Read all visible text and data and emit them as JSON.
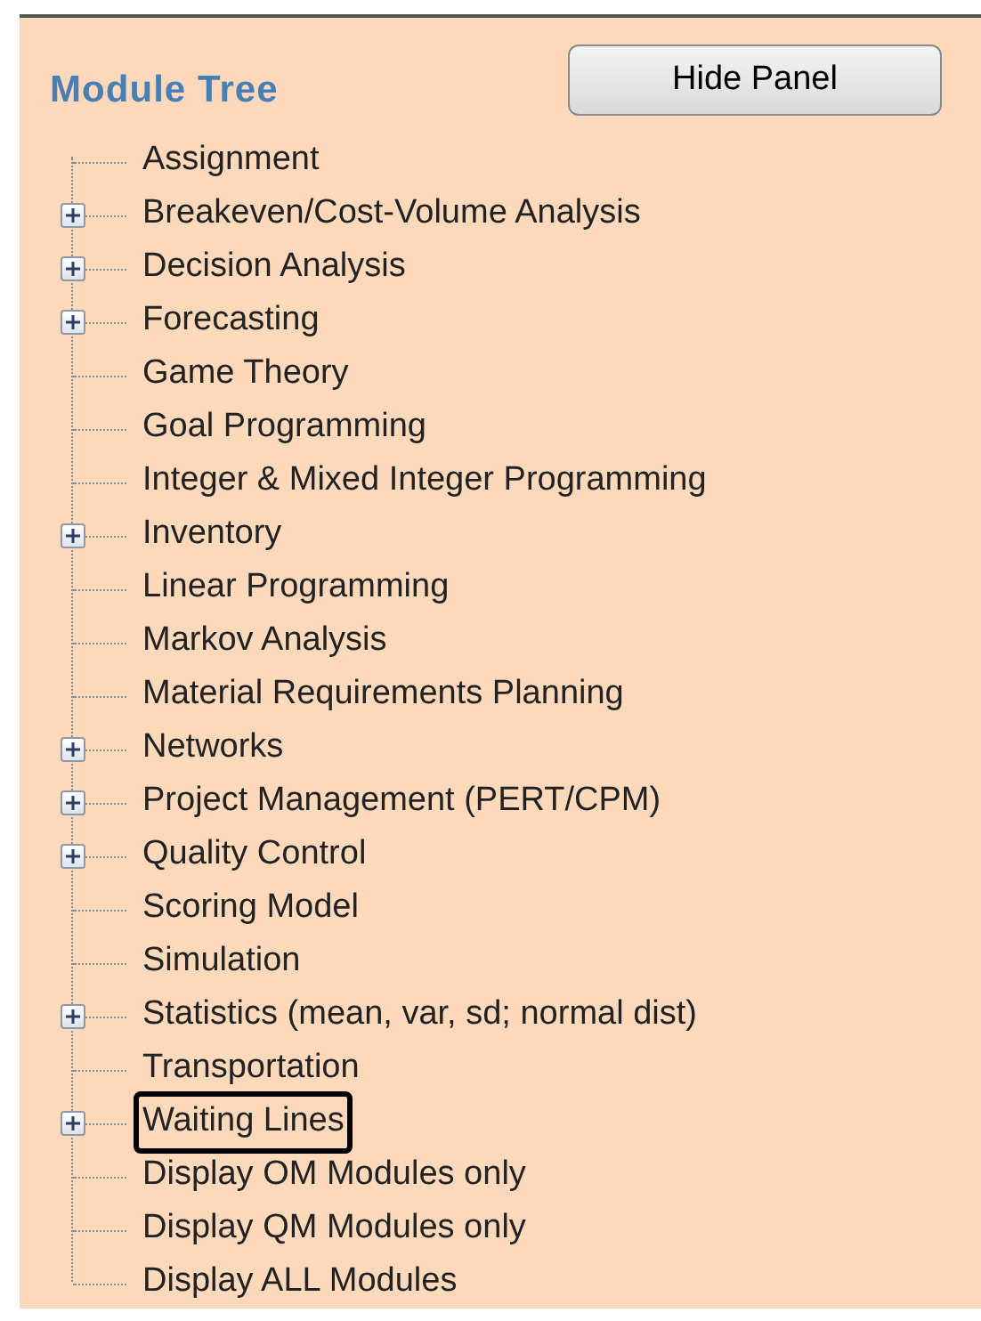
{
  "panel": {
    "title": "Module Tree",
    "hide_button": "Hide Panel"
  },
  "tree": [
    {
      "label": "Assignment",
      "expandable": false,
      "circled": false
    },
    {
      "label": "Breakeven/Cost-Volume Analysis",
      "expandable": true,
      "circled": false
    },
    {
      "label": "Decision Analysis",
      "expandable": true,
      "circled": false
    },
    {
      "label": "Forecasting",
      "expandable": true,
      "circled": false
    },
    {
      "label": "Game Theory",
      "expandable": false,
      "circled": false
    },
    {
      "label": "Goal Programming",
      "expandable": false,
      "circled": false
    },
    {
      "label": "Integer & Mixed Integer Programming",
      "expandable": false,
      "circled": false
    },
    {
      "label": "Inventory",
      "expandable": true,
      "circled": false
    },
    {
      "label": "Linear Programming",
      "expandable": false,
      "circled": false
    },
    {
      "label": "Markov Analysis",
      "expandable": false,
      "circled": false
    },
    {
      "label": "Material Requirements Planning",
      "expandable": false,
      "circled": false
    },
    {
      "label": "Networks",
      "expandable": true,
      "circled": false
    },
    {
      "label": "Project Management (PERT/CPM)",
      "expandable": true,
      "circled": false
    },
    {
      "label": "Quality Control",
      "expandable": true,
      "circled": false
    },
    {
      "label": "Scoring Model",
      "expandable": false,
      "circled": false
    },
    {
      "label": "Simulation",
      "expandable": false,
      "circled": false
    },
    {
      "label": "Statistics (mean, var, sd; normal dist)",
      "expandable": true,
      "circled": false
    },
    {
      "label": "Transportation",
      "expandable": false,
      "circled": false
    },
    {
      "label": "Waiting Lines",
      "expandable": true,
      "circled": true
    },
    {
      "label": "Display OM Modules only",
      "expandable": false,
      "circled": false
    },
    {
      "label": "Display QM Modules only",
      "expandable": false,
      "circled": false
    },
    {
      "label": "Display ALL Modules",
      "expandable": false,
      "circled": false
    }
  ]
}
